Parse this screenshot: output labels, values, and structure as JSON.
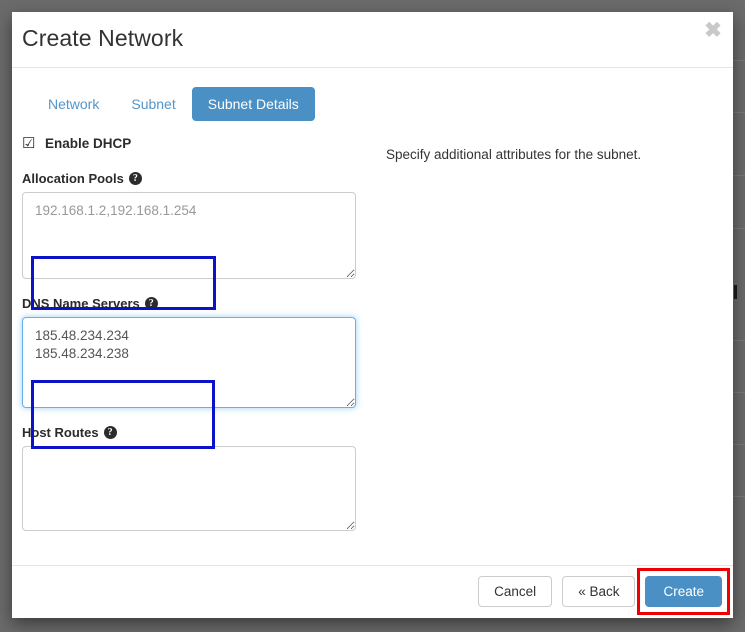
{
  "window": {
    "backdrop_color": "#6b6b6b"
  },
  "modal": {
    "title": "Create Network",
    "close_icon": "✖"
  },
  "tabs": [
    {
      "label": "Network",
      "active": false
    },
    {
      "label": "Subnet",
      "active": false
    },
    {
      "label": "Subnet Details",
      "active": true
    }
  ],
  "form": {
    "enable_dhcp": {
      "label": "Enable DHCP",
      "checked": true,
      "glyph": "☑"
    },
    "fields": [
      {
        "label": "Allocation Pools",
        "help_icon": "?",
        "value": "",
        "placeholder": "192.168.1.2,192.168.1.254",
        "focused": false
      },
      {
        "label": "DNS Name Servers",
        "help_icon": "?",
        "value": "185.48.234.234\n185.48.234.238",
        "placeholder": "",
        "focused": true
      },
      {
        "label": "Host Routes",
        "help_icon": "?",
        "value": "",
        "placeholder": "",
        "focused": false
      }
    ]
  },
  "side_panel": {
    "help_text": "Specify additional attributes for the subnet."
  },
  "footer": {
    "cancel_label": "Cancel",
    "back_label": "« Back",
    "create_label": "Create"
  },
  "annotations": {
    "highlight_color": "#0b12c8",
    "target_color": "#ee0000"
  }
}
